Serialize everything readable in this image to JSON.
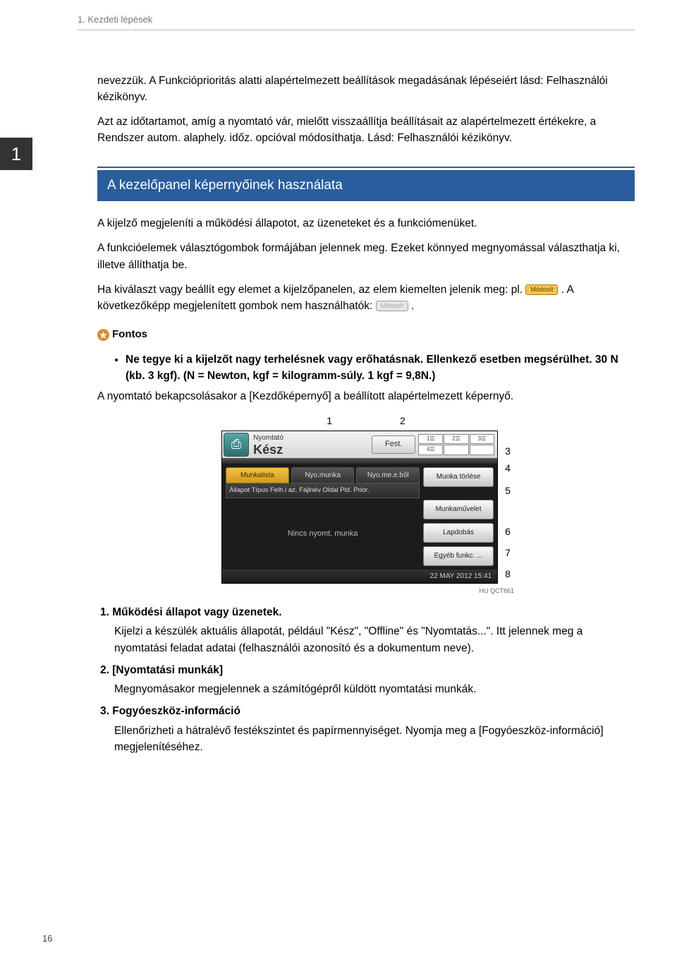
{
  "header": {
    "chapter": "1. Kezdeti lépések"
  },
  "tab": {
    "num": "1"
  },
  "intro": {
    "p1": "nevezzük. A Funkcióprioritás alatti alapértelmezett beállítások megadásának lépéseiért lásd: Felhasználói kézikönyv.",
    "p2": "Azt az időtartamot, amíg a nyomtató vár, mielőtt visszaállítja beállításait az alapértelmezett értékekre, a Rendszer autom. alaphely. időz. opcióval módosíthatja. Lásd: Felhasználói kézikönyv."
  },
  "section": {
    "title": "A kezelőpanel képernyőinek használata"
  },
  "body": {
    "p1": "A kijelző megjeleníti a működési állapotot, az üzeneteket és a funkciómenüket.",
    "p2": "A funkcióelemek választógombok formájában jelennek meg. Ezeket könnyed megnyomással választhatja ki, illetve állíthatja be.",
    "p3a": "Ha kiválaszt vagy beállít egy elemet a kijelzőpanelen, az elem kiemelten jelenik meg: pl. ",
    "btn_yellow": "Módosít",
    "p3b": ". A következőképp megjelenített gombok nem használhatók: ",
    "btn_grey": "Módosít",
    "p3c": "."
  },
  "important": {
    "label": "Fontos",
    "bullet": "Ne tegye ki a kijelzőt nagy terhelésnek vagy erőhatásnak. Ellenkező esetben megsérülhet. 30 N (kb. 3 kgf). (N = Newton, kgf = kilogramm-súly. 1 kgf = 9,8N.)"
  },
  "after_important": "A nyomtató bekapcsolásakor a [Kezdőképernyő] a beállított alapértelmezett képernyő.",
  "figure": {
    "callouts_top": [
      "1",
      "2"
    ],
    "callouts_side": [
      "3",
      "4",
      "5",
      "6",
      "7",
      "8"
    ],
    "lcd": {
      "title_small": "Nyomtató",
      "title_big": "Kész",
      "fest": "Fest.",
      "trays": [
        "1☰",
        "2☰",
        "3☰",
        "4☰",
        "",
        ""
      ],
      "tabs": [
        "Munkalista",
        "Nyo.munka",
        "Nyo.me.e.ből"
      ],
      "cols": "Állapot Típus Felh.i az.      Fájlnév      Oldal  Pld.  Prior.",
      "empty": "Nincs nyomt. munka",
      "right_btns": [
        "Munka törlése",
        "Munkaművelet",
        "Lapdobás",
        "Egyéb funkc. ..."
      ],
      "timestamp": "22 MAY   2012 15:41"
    },
    "code": "HU QCT661"
  },
  "list": {
    "i1h": "1.  Működési állapot vagy üzenetek.",
    "i1b": "Kijelzi a készülék aktuális állapotát, például \"Kész\", \"Offline\" és \"Nyomtatás...\". Itt jelennek meg a nyomtatási feladat adatai (felhasználói azonosító és a dokumentum neve).",
    "i2h": "2.  [Nyomtatási munkák]",
    "i2b": "Megnyomásakor megjelennek a számítógépről küldött nyomtatási munkák.",
    "i3h": "3.  Fogyóeszköz-információ",
    "i3b": "Ellenőrizheti a hátralévő festékszintet és papírmennyiséget. Nyomja meg a [Fogyóeszköz-információ] megjelenítéséhez."
  },
  "page_num": "16"
}
